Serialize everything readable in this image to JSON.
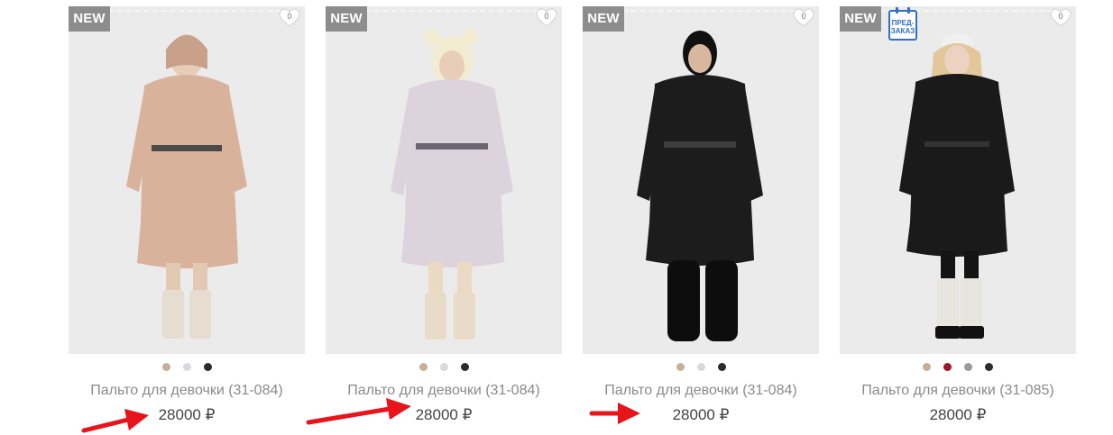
{
  "products": [
    {
      "badge": "NEW",
      "favorite_count": "0",
      "name": "Пальто для девочки (31-084)",
      "price": "28000 ₽",
      "coat_color": "#d9b29c",
      "swatches": [
        {
          "color": "#c9ad98"
        },
        {
          "color": "#dcd6de"
        },
        {
          "color": "#2b2b2b"
        }
      ]
    },
    {
      "badge": "NEW",
      "favorite_count": "0",
      "name": "Пальто для девочки (31-084)",
      "price": "28000 ₽",
      "coat_color": "#ddd3dc",
      "swatches": [
        {
          "color": "#c9ad98"
        },
        {
          "color": "#dcd6de"
        },
        {
          "color": "#2b2b2b"
        }
      ]
    },
    {
      "badge": "NEW",
      "favorite_count": "0",
      "name": "Пальто для девочки (31-084)",
      "price": "28000 ₽",
      "coat_color": "#1c1c1c",
      "swatches": [
        {
          "color": "#c9ad98"
        },
        {
          "color": "#dcd6de"
        },
        {
          "color": "#2b2b2b"
        }
      ]
    },
    {
      "badge": "NEW",
      "preorder_line1": "ПРЕД-",
      "preorder_line2": "ЗАКАЗ",
      "favorite_count": "0",
      "name": "Пальто для девочки (31-085)",
      "price": "28000 ₽",
      "coat_color": "#1a1a1a",
      "swatches": [
        {
          "color": "#c9ad98"
        },
        {
          "color": "#a1142a"
        },
        {
          "color": "#9a9a9a"
        },
        {
          "color": "#2b2b2b"
        }
      ]
    }
  ],
  "annotation_arrow_color": "#e8141a"
}
